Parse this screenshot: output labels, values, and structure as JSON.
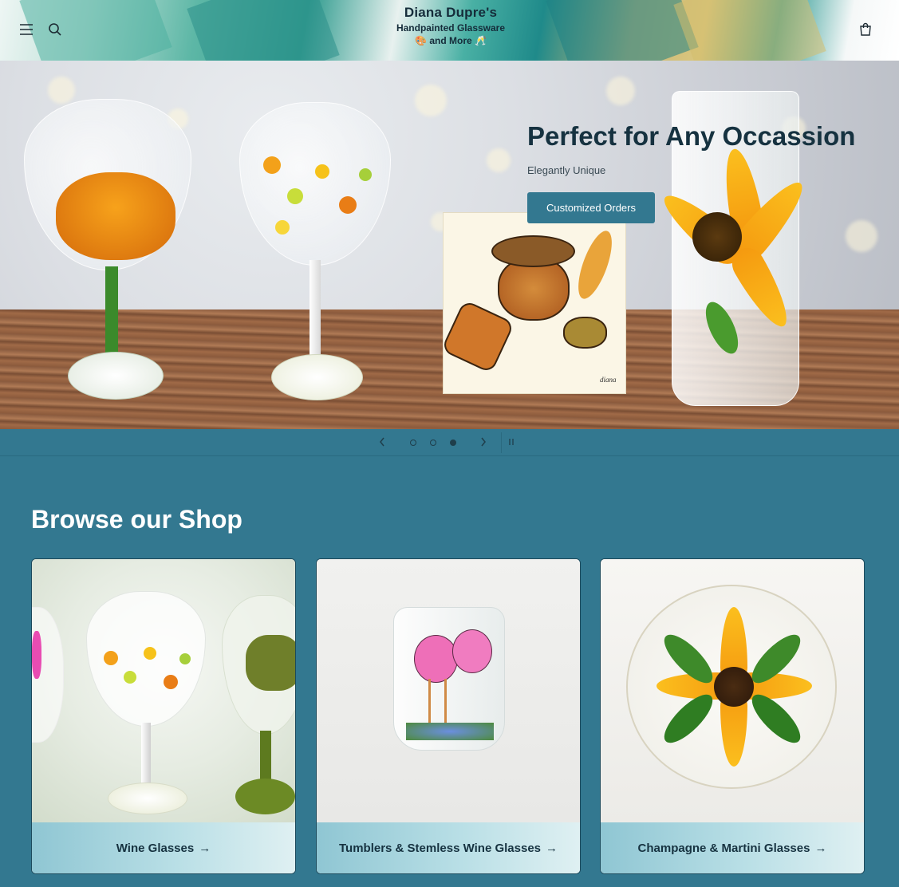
{
  "header": {
    "logo_line1": "Diana Dupre's",
    "logo_line2": "Handpainted Glassware",
    "logo_line3": "and More",
    "menu_icon": "hamburger-menu-icon",
    "search_icon": "search-icon",
    "cart_icon": "cart-icon"
  },
  "hero": {
    "title": "Perfect for Any Occassion",
    "subtitle": "Elegantly Unique",
    "button_label": "Customized Orders",
    "tile_signature": "diana"
  },
  "slider": {
    "prev_icon": "chevron-left-icon",
    "next_icon": "chevron-right-icon",
    "pause_icon": "pause-icon",
    "active_slide": 3,
    "slide_count": 3
  },
  "browse": {
    "title": "Browse our Shop",
    "arrow": "→",
    "cards": [
      {
        "label": "Wine Glasses"
      },
      {
        "label": "Tumblers & Stemless Wine Glasses"
      },
      {
        "label": "Champagne & Martini Glasses"
      }
    ]
  },
  "colors": {
    "primary": "#337890",
    "heading_dark": "#163240"
  }
}
